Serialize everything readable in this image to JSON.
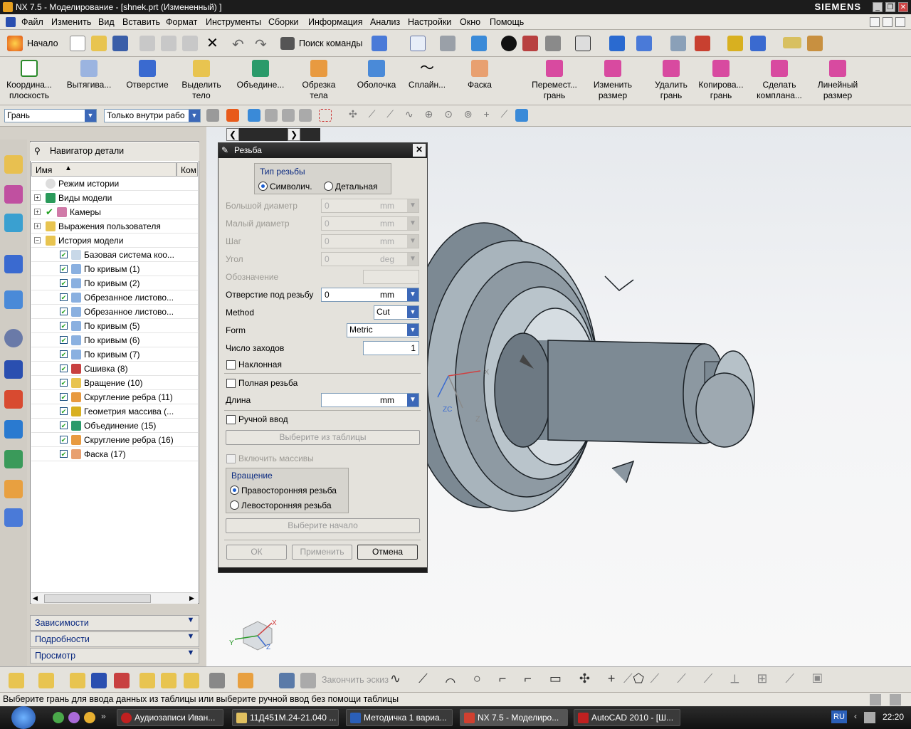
{
  "window": {
    "title": "NX 7.5 - Моделирование - [shnek.prt (Измененный) ]",
    "brand": "SIEMENS"
  },
  "menu": [
    "Файл",
    "Изменить",
    "Вид",
    "Вставить",
    "Формат",
    "Инструменты",
    "Сборки",
    "Информация",
    "Анализ",
    "Настройки",
    "Окно",
    "Помощь"
  ],
  "toolbar1": {
    "start": "Начало",
    "search": "Поиск команды"
  },
  "toolbar2": [
    {
      "l1": "Координа...",
      "l2": "плоскость"
    },
    {
      "l1": "Вытягива...",
      "l2": ""
    },
    {
      "l1": "Отверстие",
      "l2": ""
    },
    {
      "l1": "Выделить",
      "l2": "тело"
    },
    {
      "l1": "Объедине...",
      "l2": ""
    },
    {
      "l1": "Обрезка",
      "l2": "тела"
    },
    {
      "l1": "Оболочка",
      "l2": ""
    },
    {
      "l1": "Сплайн...",
      "l2": ""
    },
    {
      "l1": "Фаска",
      "l2": ""
    },
    {
      "l1": "Перемест...",
      "l2": "грань"
    },
    {
      "l1": "Изменить",
      "l2": "размер"
    },
    {
      "l1": "Удалить",
      "l2": "грань"
    },
    {
      "l1": "Копирова...",
      "l2": "грань"
    },
    {
      "l1": "Сделать",
      "l2": "комплана..."
    },
    {
      "l1": "Линейный",
      "l2": "размер"
    }
  ],
  "selection": {
    "filter": "Грань",
    "scope": "Только внутри рабо"
  },
  "navigator": {
    "title": "Навигатор детали",
    "col_name": "Имя",
    "col_comment": "Ком",
    "items": [
      {
        "label": "Режим истории",
        "level": 0,
        "check": false
      },
      {
        "label": "Виды модели",
        "level": 0,
        "check": false
      },
      {
        "label": "Камеры",
        "level": 0,
        "check": true
      },
      {
        "label": "Выражения пользователя",
        "level": 0,
        "check": false
      },
      {
        "label": "История модели",
        "level": 0,
        "check": false
      },
      {
        "label": "Базовая система коо...",
        "level": 1,
        "check": true
      },
      {
        "label": "По кривым (1)",
        "level": 1,
        "check": true
      },
      {
        "label": "По кривым (2)",
        "level": 1,
        "check": true
      },
      {
        "label": "Обрезанное листово...",
        "level": 1,
        "check": true
      },
      {
        "label": "Обрезанное листово...",
        "level": 1,
        "check": true
      },
      {
        "label": "По кривым (5)",
        "level": 1,
        "check": true
      },
      {
        "label": "По кривым (6)",
        "level": 1,
        "check": true
      },
      {
        "label": "По кривым (7)",
        "level": 1,
        "check": true
      },
      {
        "label": "Сшивка (8)",
        "level": 1,
        "check": true
      },
      {
        "label": "Вращение (10)",
        "level": 1,
        "check": true
      },
      {
        "label": "Скругление ребра (11)",
        "level": 1,
        "check": true
      },
      {
        "label": "Геометрия массива (...",
        "level": 1,
        "check": true
      },
      {
        "label": "Объединение (15)",
        "level": 1,
        "check": true
      },
      {
        "label": "Скругление ребра (16)",
        "level": 1,
        "check": true
      },
      {
        "label": "Фаска (17)",
        "level": 1,
        "check": true
      }
    ],
    "panels": [
      "Зависимости",
      "Подробности",
      "Просмотр"
    ]
  },
  "dialog": {
    "title": "Резьба",
    "type_group": "Тип резьбы",
    "type_options": [
      "Символич.",
      "Детальная"
    ],
    "major_dia": {
      "label": "Большой диаметр",
      "value": "0",
      "unit": "mm"
    },
    "minor_dia": {
      "label": "Малый диаметр",
      "value": "0",
      "unit": "mm"
    },
    "pitch": {
      "label": "Шаг",
      "value": "0",
      "unit": "mm"
    },
    "angle": {
      "label": "Угол",
      "value": "0",
      "unit": "deg"
    },
    "designation": {
      "label": "Обозначение"
    },
    "tap_drill": {
      "label": "Отверстие под резьбу",
      "value": "0",
      "unit": "mm"
    },
    "method": {
      "label": "Method",
      "value": "Cut"
    },
    "form": {
      "label": "Form",
      "value": "Metric"
    },
    "starts": {
      "label": "Число заходов",
      "value": "1"
    },
    "tapered": "Наклонная",
    "full_thread": "Полная резьба",
    "length": {
      "label": "Длина",
      "unit": "mm"
    },
    "manual": "Ручной ввод",
    "from_table": "Выберите из таблицы",
    "include_instances": "Включить массивы",
    "rotation_group": "Вращение",
    "rotation_options": [
      "Правосторонняя резьба",
      "Левосторонняя резьба"
    ],
    "select_start": "Выберите начало",
    "ok": "ОК",
    "apply": "Применить",
    "cancel": "Отмена"
  },
  "sketch_finish": "Закончить эскиз",
  "status": "Выберите грань для ввода данных из таблицы или выберите ручной ввод без помощи таблицы",
  "taskbar": [
    {
      "label": "Аудиозаписи Иван...",
      "color": "#c02020"
    },
    {
      "label": "11Д451М.24-21.040 ...",
      "color": "#e0c060"
    },
    {
      "label": "Методичка 1 вариа...",
      "color": "#2b5fb8"
    },
    {
      "label": "NX 7.5 - Моделиро...",
      "color": "#d04030"
    },
    {
      "label": "AutoCAD 2010 - [Ш...",
      "color": "#c02020"
    }
  ],
  "lang": "RU",
  "clock": "22:20",
  "triad": {
    "x": "X",
    "y": "Y",
    "z": "Z",
    "zc": "ZC",
    "xc": "XC",
    "yc": "YC"
  }
}
